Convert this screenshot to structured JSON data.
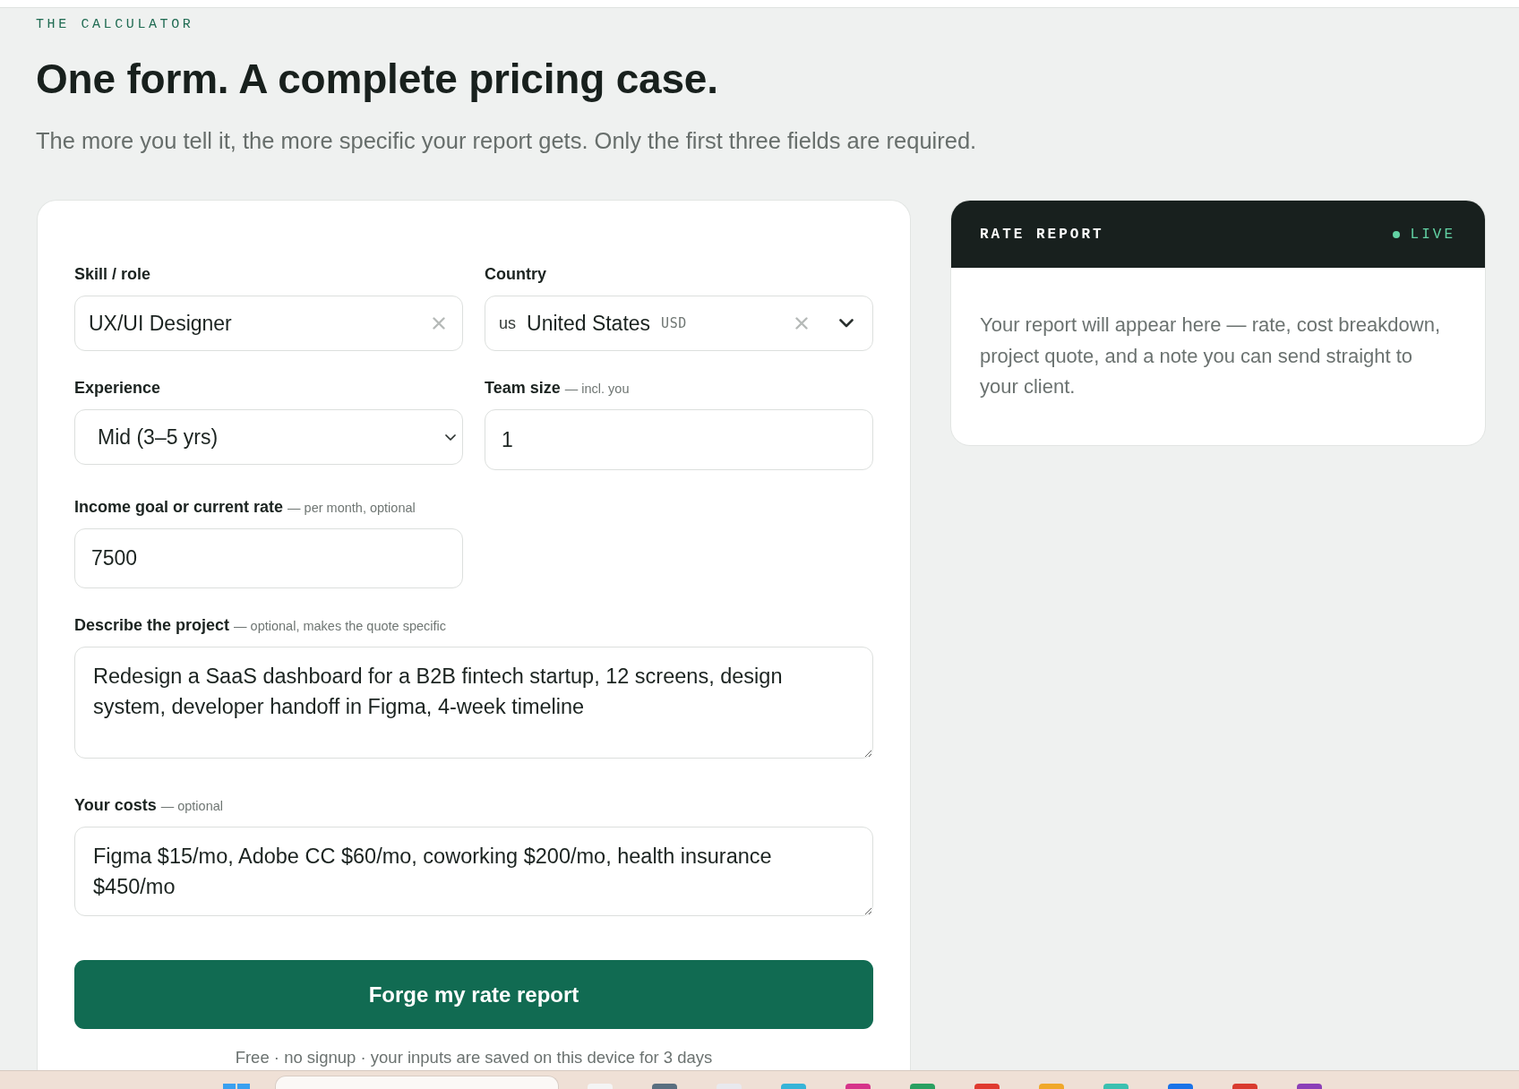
{
  "eyebrow": "THE CALCULATOR",
  "title": "One form. A complete pricing case.",
  "subtitle": "The more you tell it, the more specific your report gets. Only the first three fields are required.",
  "form": {
    "fields": [
      {
        "kind": "combobox",
        "label": "Skill / role",
        "value": "UX/UI Designer",
        "clearable": true
      },
      {
        "kind": "country",
        "label": "Country",
        "flag": "us",
        "value": "United States",
        "currency": "USD",
        "clearable": true
      },
      {
        "kind": "select",
        "label": "Experience",
        "value": "Mid (3–5 yrs)"
      },
      {
        "kind": "number",
        "label": "Team size",
        "hint": "— incl. you",
        "value": "1"
      },
      {
        "kind": "text",
        "label": "Income goal or current rate",
        "hint": "— per month, optional",
        "value": "7500"
      },
      {
        "kind": "textarea",
        "label": "Describe the project",
        "hint": "— optional, makes the quote specific",
        "value": "Redesign a SaaS dashboard for a B2B fintech startup, 12 screens, design system, developer handoff in Figma, 4-week timeline"
      },
      {
        "kind": "textarea",
        "label": "Your costs",
        "hint": "— optional",
        "value": "Figma $15/mo, Adobe CC $60/mo, coworking $200/mo, health insurance $450/mo"
      }
    ],
    "submit": "Forge my rate report",
    "footnote": "Free · no signup · your inputs are saved on this device for 3 days"
  },
  "report": {
    "title": "RATE REPORT",
    "status": "LIVE",
    "text": "Your report will appear here — rate, cost breakdown, project quote, and a note you can send straight to your client."
  }
}
